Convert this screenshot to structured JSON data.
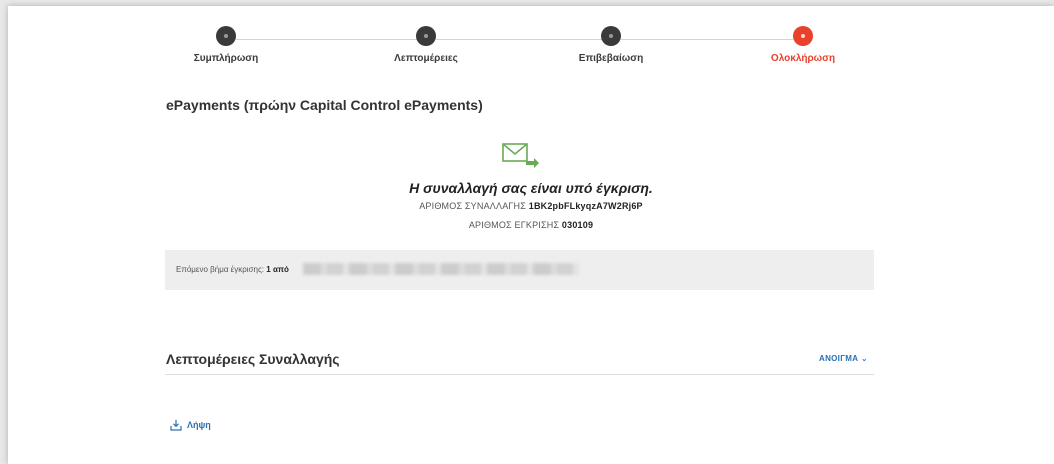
{
  "stepper": {
    "steps": [
      {
        "label": "Συμπλήρωση"
      },
      {
        "label": "Λεπτομέρειες"
      },
      {
        "label": "Επιβεβαίωση"
      },
      {
        "label": "Ολοκλήρωση"
      }
    ],
    "active_step": 4
  },
  "page": {
    "title": "ePayments (πρώην Capital Control ePayments)"
  },
  "status": {
    "icon": "mail-forward-icon",
    "message": "Η συναλλαγή σας είναι υπό έγκριση.",
    "transaction_label": "ΑΡΙΘΜΟΣ ΣΥΝΑΛΛΑΓΗΣ",
    "transaction_value": "1BK2pbFLkyqzA7W2Rj6P",
    "approval_label": "ΑΡΙΘΜΟΣ ΕΓΚΡΙΣΗΣ",
    "approval_value": "030109"
  },
  "next_step": {
    "label": "Επόμενο βήμα έγκρισης:",
    "count": "1 από"
  },
  "details": {
    "title": "Λεπτομέρειες Συναλλαγής",
    "toggle_label": "ΑΝΟΙΓΜΑ",
    "toggle_icon": "chevron-down-icon"
  },
  "download": {
    "label": "Λήψη",
    "icon": "download-icon"
  },
  "colors": {
    "accent": "#e8412c",
    "link": "#2a6fb5",
    "success_icon": "#6aaa57"
  }
}
